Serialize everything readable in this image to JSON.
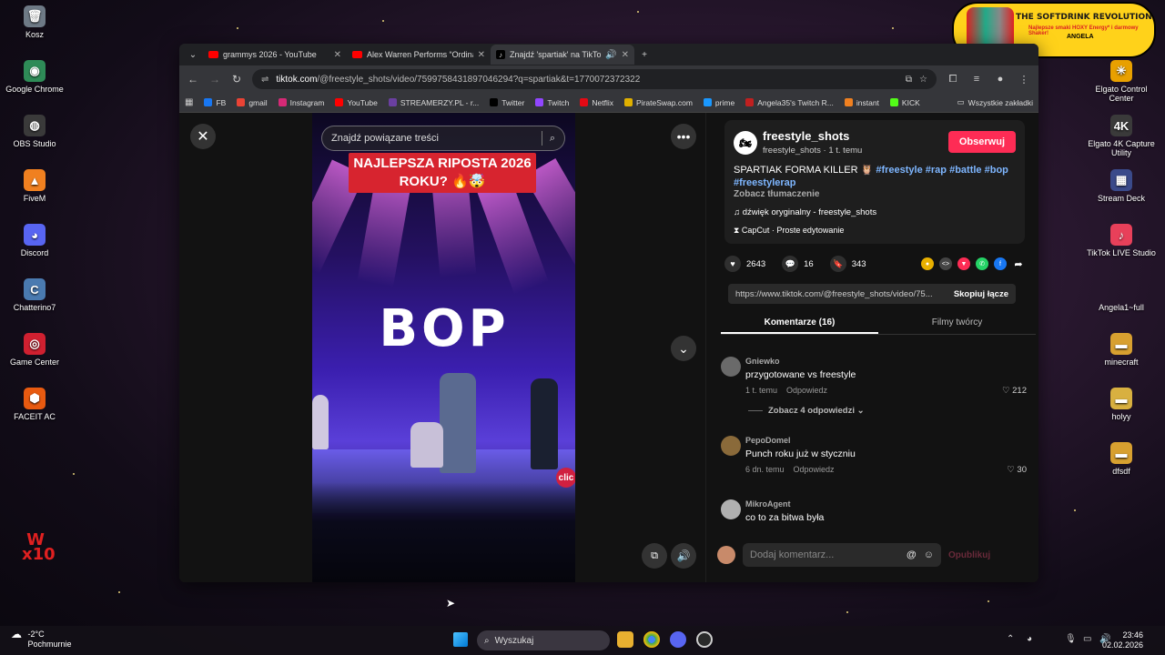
{
  "desktop": {
    "left_icons": [
      {
        "label": "Kosz",
        "glyph": "🗑",
        "color": "#6e7a86"
      },
      {
        "label": "Google Chrome",
        "glyph": "◉",
        "color": "#2e8b57"
      },
      {
        "label": "OBS Studio",
        "glyph": "◍",
        "color": "#3a3a3a"
      },
      {
        "label": "FiveM",
        "glyph": "▲",
        "color": "#f08020"
      },
      {
        "label": "Discord",
        "glyph": "◕",
        "color": "#5865f2"
      },
      {
        "label": "Chatterino7",
        "glyph": "C",
        "color": "#4a7ab0"
      },
      {
        "label": "Game Center",
        "glyph": "◎",
        "color": "#d02030"
      },
      {
        "label": "FACEIT AC",
        "glyph": "⬢",
        "color": "#e85a10"
      }
    ],
    "x10_logo": "W x10",
    "right_icons": [
      {
        "label": "Elgato Control Center",
        "glyph": "✳",
        "color": "#e8a000"
      },
      {
        "label": "Elgato 4K Capture Utility",
        "glyph": "4K",
        "color": "#3a3a3a"
      },
      {
        "label": "Stream Deck",
        "glyph": "▦",
        "color": "#3a4a8a"
      },
      {
        "label": "TikTok LIVE Studio",
        "glyph": "♪",
        "color": "#e8405a"
      },
      {
        "label": "Angela1~full",
        "glyph": "",
        "color": "transparent"
      },
      {
        "label": "minecraft",
        "glyph": "▬",
        "color": "#d8a030"
      },
      {
        "label": "holyy",
        "glyph": "▬",
        "color": "#d8b040"
      },
      {
        "label": "dfsdf",
        "glyph": "▬",
        "color": "#d8a030"
      }
    ],
    "banner": {
      "title": "THE SOFTDRINK REVOLUTION",
      "subtitle": "Najlepsze smaki HOXY Energy* i darmowy Shaker!",
      "name": "ANGELA"
    }
  },
  "browser": {
    "tabs": [
      {
        "title": "grammys 2026 - YouTube",
        "icon": "youtube"
      },
      {
        "title": "Alex Warren Performs “Ordinary”",
        "icon": "youtube"
      },
      {
        "title": "Znajdź 'spartiak' na TikTok | TikTok",
        "icon": "tiktok"
      }
    ],
    "new_tab": "+",
    "url_host": "tiktok.com",
    "url_path": "/@freestyle_shots/video/7599758431897046294?q=spartiak&t=1770072372322",
    "bookmarks": [
      {
        "label": "FB",
        "color": "#1877f2"
      },
      {
        "label": "gmail",
        "color": "#ea4335"
      },
      {
        "label": "Instagram",
        "color": "#d62976"
      },
      {
        "label": "YouTube",
        "color": "#ff0000"
      },
      {
        "label": "STREAMERZY.PL - r...",
        "color": "#6a3fa0"
      },
      {
        "label": "Twitter",
        "color": "#000000"
      },
      {
        "label": "Twitch",
        "color": "#9146ff"
      },
      {
        "label": "Netflix",
        "color": "#e50914"
      },
      {
        "label": "PirateSwap.com",
        "color": "#e0b000"
      },
      {
        "label": "prime",
        "color": "#1a98ff"
      },
      {
        "label": "Angela35's Twitch R...",
        "color": "#c02020"
      },
      {
        "label": "instant",
        "color": "#f08020"
      },
      {
        "label": "KICK",
        "color": "#53fc18"
      }
    ],
    "all_bookmarks": "Wszystkie zakładki"
  },
  "video": {
    "search_placeholder": "Znajdź powiązane treści",
    "overlay_text": "NAJLEPSZA RIPOSTA 2026 ROKU? 🔥🤯",
    "stage_text": "BOP",
    "corner_text": "clic"
  },
  "post": {
    "username": "freestyle_shots",
    "subline": "freestyle_shots · 1 t. temu",
    "follow": "Obserwuj",
    "desc_text": "SPARTIAK FORMA KILLER 🦉",
    "hashtags": [
      "#freestyle",
      "#rap",
      "#battle",
      "#bop",
      "#freestylerap"
    ],
    "translate": "Zobacz tłumaczenie",
    "music": "dźwięk oryginalny - freestyle_shots",
    "capcut": "CapCut · Proste edytowanie",
    "likes": "2643",
    "comments": "16",
    "saves": "343",
    "link": "https://www.tiktok.com/@freestyle_shots/video/75...",
    "copy": "Skopiuj łącze",
    "tab_comments": "Komentarze (16)",
    "tab_creator": "Filmy twórcy"
  },
  "comments": [
    {
      "name": "Gniewko",
      "text": "przygotowane vs freestyle",
      "time": "1 t. temu",
      "reply": "Odpowiedz",
      "likes": "212",
      "avatar": "#6a6a6a"
    },
    {
      "name": "PepoDomel",
      "text": "Punch roku już w styczniu",
      "time": "6 dn. temu",
      "reply": "Odpowiedz",
      "likes": "30",
      "avatar": "#8a6a3a"
    },
    {
      "name": "MikroAgent",
      "text": "co to za bitwa była",
      "time": "",
      "reply": "",
      "likes": "",
      "avatar": "#b0b0b0"
    }
  ],
  "more_replies": "Zobacz 4 odpowiedzi",
  "add_comment": {
    "placeholder": "Dodaj komentarz...",
    "post": "Opublikuj"
  },
  "taskbar": {
    "weather_temp": "-2°C",
    "weather_desc": "Pochmurnie",
    "search": "Wyszukaj",
    "time": "23:46",
    "date": "02.02.2026"
  }
}
